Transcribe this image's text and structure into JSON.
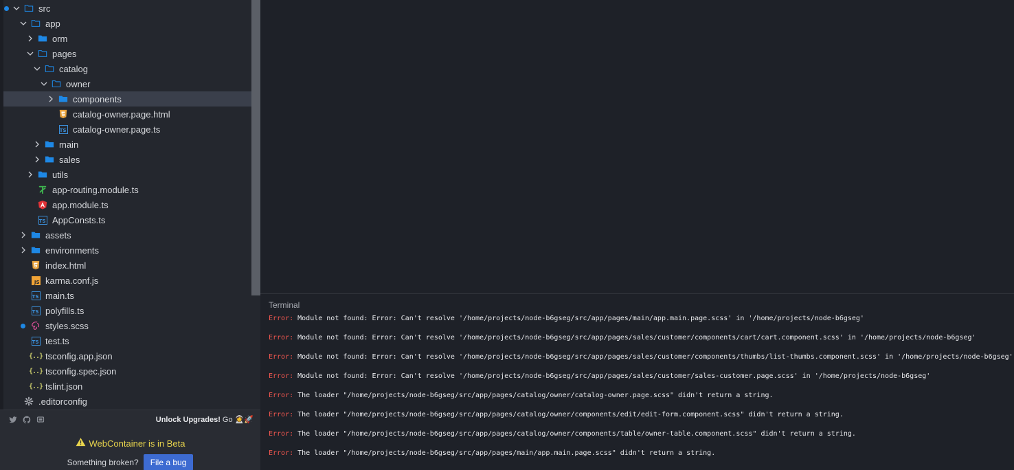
{
  "explorer": {
    "items": [
      {
        "label": "src",
        "depth": 0,
        "kind": "folder-open",
        "expanded": true,
        "modified": true
      },
      {
        "label": "app",
        "depth": 1,
        "kind": "folder-open",
        "expanded": true
      },
      {
        "label": "orm",
        "depth": 2,
        "kind": "folder",
        "expanded": false
      },
      {
        "label": "pages",
        "depth": 2,
        "kind": "folder-open",
        "expanded": true
      },
      {
        "label": "catalog",
        "depth": 3,
        "kind": "folder-open",
        "expanded": true
      },
      {
        "label": "owner",
        "depth": 4,
        "kind": "folder-open",
        "expanded": true
      },
      {
        "label": "components",
        "depth": 5,
        "kind": "folder",
        "expanded": false,
        "selected": true
      },
      {
        "label": "catalog-owner.page.html",
        "depth": 5,
        "kind": "html"
      },
      {
        "label": "catalog-owner.page.ts",
        "depth": 5,
        "kind": "ts"
      },
      {
        "label": "main",
        "depth": 3,
        "kind": "folder",
        "expanded": false
      },
      {
        "label": "sales",
        "depth": 3,
        "kind": "folder",
        "expanded": false
      },
      {
        "label": "utils",
        "depth": 2,
        "kind": "folder",
        "expanded": false
      },
      {
        "label": "app-routing.module.ts",
        "depth": 2,
        "kind": "routing"
      },
      {
        "label": "app.module.ts",
        "depth": 2,
        "kind": "angular"
      },
      {
        "label": "AppConsts.ts",
        "depth": 2,
        "kind": "ts"
      },
      {
        "label": "assets",
        "depth": 1,
        "kind": "folder",
        "expanded": false
      },
      {
        "label": "environments",
        "depth": 1,
        "kind": "folder",
        "expanded": false
      },
      {
        "label": "index.html",
        "depth": 1,
        "kind": "html"
      },
      {
        "label": "karma.conf.js",
        "depth": 1,
        "kind": "js"
      },
      {
        "label": "main.ts",
        "depth": 1,
        "kind": "ts"
      },
      {
        "label": "polyfills.ts",
        "depth": 1,
        "kind": "ts"
      },
      {
        "label": "styles.scss",
        "depth": 1,
        "kind": "scss",
        "modified": true
      },
      {
        "label": "test.ts",
        "depth": 1,
        "kind": "ts"
      },
      {
        "label": "tsconfig.app.json",
        "depth": 1,
        "kind": "json"
      },
      {
        "label": "tsconfig.spec.json",
        "depth": 1,
        "kind": "json"
      },
      {
        "label": "tslint.json",
        "depth": 1,
        "kind": "json"
      },
      {
        "label": ".editorconfig",
        "depth": 0,
        "kind": "gear"
      }
    ]
  },
  "footer": {
    "social_icons": [
      "twitter-icon",
      "github-icon",
      "discord-icon"
    ],
    "unlock_label": "Unlock Upgrades!",
    "go_label": "Go",
    "go_emoji": "👩‍🚀🚀",
    "beta_text": "WebContainer is in Beta",
    "broken_text": "Something broken?",
    "file_bug_label": "File a bug"
  },
  "terminal": {
    "title": "Terminal",
    "lines": [
      {
        "prefix": "Error:",
        "text": " Module not found: Error: Can't resolve '/home/projects/node-b6gseg/src/app/pages/main/app.main.page.scss' in '/home/projects/node-b6gseg'"
      },
      {
        "prefix": "Error:",
        "text": " Module not found: Error: Can't resolve '/home/projects/node-b6gseg/src/app/pages/sales/customer/components/cart/cart.component.scss' in '/home/projects/node-b6gseg'"
      },
      {
        "prefix": "Error:",
        "text": " Module not found: Error: Can't resolve '/home/projects/node-b6gseg/src/app/pages/sales/customer/components/thumbs/list-thumbs.component.scss' in '/home/projects/node-b6gseg'"
      },
      {
        "prefix": "Error:",
        "text": " Module not found: Error: Can't resolve '/home/projects/node-b6gseg/src/app/pages/sales/customer/sales-customer.page.scss' in '/home/projects/node-b6gseg'"
      },
      {
        "prefix": "Error:",
        "text": " The loader \"/home/projects/node-b6gseg/src/app/pages/catalog/owner/catalog-owner.page.scss\" didn't return a string."
      },
      {
        "prefix": "Error:",
        "text": " The loader \"/home/projects/node-b6gseg/src/app/pages/catalog/owner/components/edit/edit-form.component.scss\" didn't return a string."
      },
      {
        "prefix": "Error:",
        "text": " The loader \"/home/projects/node-b6gseg/src/app/pages/catalog/owner/components/table/owner-table.component.scss\" didn't return a string."
      },
      {
        "prefix": "Error:",
        "text": " The loader \"/home/projects/node-b6gseg/src/app/pages/main/app.main.page.scss\" didn't return a string."
      }
    ]
  },
  "colors": {
    "accent": "#3d6bd1",
    "folder": "#1e88e5",
    "error": "#f0564f",
    "warning": "#e8d44d",
    "modified_dot": "#1e88e5"
  }
}
